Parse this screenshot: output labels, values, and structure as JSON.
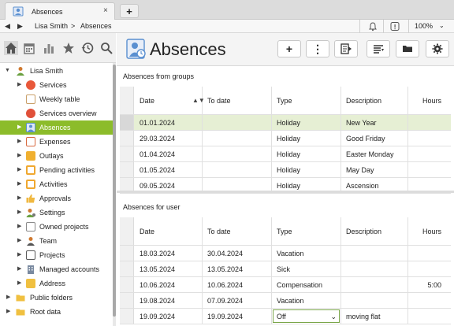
{
  "window": {
    "tab_title": "Absences",
    "tab_close": "×",
    "tab_add": "+"
  },
  "addressbar": {
    "back": "◀",
    "forward": "▶",
    "breadcrumbs": [
      "Lisa Smith",
      "Absences"
    ],
    "crumb_separator": ">",
    "zoom": "100%",
    "zoom_caret": "⌄"
  },
  "sidebar": {
    "tools": [
      "home-icon",
      "calendar-icon",
      "chart-icon",
      "star-icon",
      "history-icon",
      "search-icon"
    ],
    "user": {
      "label": "Lisa Smith",
      "expanded": "▼"
    },
    "items": [
      {
        "label": "Services",
        "icon": "services-icon",
        "color": "#e8583a",
        "arrow": "▶"
      },
      {
        "label": "Weekly table",
        "icon": "weekly-table-icon",
        "color": "#c9a06a",
        "arrow": ""
      },
      {
        "label": "Services overview",
        "icon": "services-overview-icon",
        "color": "#e0503a",
        "arrow": ""
      },
      {
        "label": "Absences",
        "icon": "absences-icon",
        "color": "#5a8fd0",
        "arrow": "▶"
      },
      {
        "label": "Expenses",
        "icon": "expenses-icon",
        "color": "#d86a40",
        "arrow": "▶"
      },
      {
        "label": "Outlays",
        "icon": "outlays-icon",
        "color": "#f0b030",
        "arrow": "▶"
      },
      {
        "label": "Pending activities",
        "icon": "pending-activities-icon",
        "color": "#f0a830",
        "arrow": "▶"
      },
      {
        "label": "Activities",
        "icon": "activities-icon",
        "color": "#f0a830",
        "arrow": "▶"
      },
      {
        "label": "Approvals",
        "icon": "approvals-icon",
        "color": "#f0b840",
        "arrow": "▶"
      },
      {
        "label": "Settings",
        "icon": "settings-icon",
        "color": "#6aa040",
        "arrow": "▶"
      },
      {
        "label": "Owned projects",
        "icon": "owned-projects-icon",
        "color": "#8a8a8a",
        "arrow": "▶"
      },
      {
        "label": "Team",
        "icon": "team-icon",
        "color": "#d07a30",
        "arrow": "▶"
      },
      {
        "label": "Projects",
        "icon": "projects-icon",
        "color": "#5a5a5a",
        "arrow": "▶"
      },
      {
        "label": "Managed accounts",
        "icon": "managed-accounts-icon",
        "color": "#7a8aa0",
        "arrow": "▶"
      },
      {
        "label": "Address",
        "icon": "address-icon",
        "color": "#f0c040",
        "arrow": "▶"
      }
    ],
    "root_items": [
      {
        "label": "Public folders",
        "icon": "folder-icon",
        "color": "#f0c040",
        "arrow": "▶"
      },
      {
        "label": "Root data",
        "icon": "folder-icon",
        "color": "#f0c040",
        "arrow": "▶"
      }
    ],
    "selected_index": 3,
    "accent": "#8cbc2a"
  },
  "header": {
    "title": "Absences",
    "buttons": [
      {
        "name": "add-button",
        "glyph": "+"
      },
      {
        "name": "more-button",
        "glyph": "⋮"
      },
      {
        "name": "document-button",
        "glyph": ""
      },
      {
        "name": "list-sort-button",
        "glyph": ""
      },
      {
        "name": "folder-button",
        "glyph": ""
      },
      {
        "name": "settings-button",
        "glyph": ""
      }
    ]
  },
  "groups_table": {
    "title": "Absences from groups",
    "columns": [
      "Date",
      "To date",
      "Type",
      "Description",
      "Hours"
    ],
    "sort_glyph": "▲▼",
    "rows": [
      [
        "01.01.2024",
        "",
        "Holiday",
        "New Year",
        ""
      ],
      [
        "29.03.2024",
        "",
        "Holiday",
        "Good Friday",
        ""
      ],
      [
        "01.04.2024",
        "",
        "Holiday",
        "Easter Monday",
        ""
      ],
      [
        "01.05.2024",
        "",
        "Holiday",
        "May Day",
        ""
      ],
      [
        "09.05.2024",
        "",
        "Holiday",
        "Ascension",
        ""
      ]
    ],
    "highlight_row": 0
  },
  "user_table": {
    "title": "Absences for user",
    "columns": [
      "Date",
      "To date",
      "Type",
      "Description",
      "Hours"
    ],
    "rows": [
      [
        "18.03.2024",
        "30.04.2024",
        "Vacation",
        "",
        ""
      ],
      [
        "13.05.2024",
        "13.05.2024",
        "Sick",
        "",
        ""
      ],
      [
        "10.06.2024",
        "10.06.2024",
        "Compensation",
        "",
        "5:00"
      ],
      [
        "19.08.2024",
        "07.09.2024",
        "Vacation",
        "",
        ""
      ],
      [
        "19.09.2024",
        "19.09.2024",
        "Off",
        "moving flat",
        ""
      ]
    ],
    "edit_row": 4,
    "edit_caret": "⌄"
  }
}
